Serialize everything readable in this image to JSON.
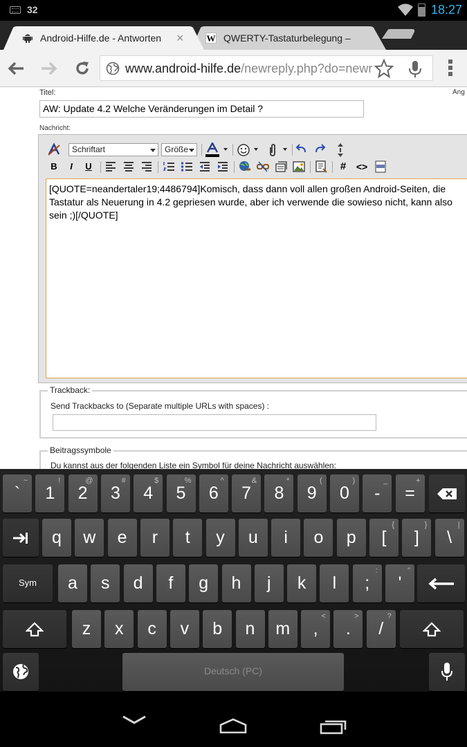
{
  "status_bar": {
    "notification_count": "32",
    "time": "18:27"
  },
  "tabs": [
    {
      "title": "Android-Hilfe.de - Antworten",
      "close": "×"
    },
    {
      "title": "QWERTY-Tastaturbelegung –",
      "favicon": "W"
    }
  ],
  "omnibox": {
    "url_host": "www.android-hilfe.de",
    "url_path": "/newreply.php?do=newrep"
  },
  "form": {
    "title_label": "Titel:",
    "right_edge_text": "Ang",
    "title_value": "AW: Update 4.2 Welche Veränderungen im Detail ?",
    "message_label": "Nachricht:",
    "font_select": "Schriftart",
    "size_select": "Größe",
    "bold": "B",
    "italic": "I",
    "underline": "U",
    "hash": "#",
    "code": "<>",
    "message_text": "[QUOTE=neandertaler19;4486794]Komisch, dass dann voll allen großen Android-Seiten, die Tastatur als Neuerung in 4.2 gepriesen wurde, aber ich verwende die sowieso nicht, kann also sein ;)[/QUOTE]",
    "trackback_legend": "Trackback:",
    "trackback_hint": "Send Trackbacks to (Separate multiple URLs with spaces) :",
    "symbols_legend": "Beitragssymbole",
    "symbols_text": "Du kannst aus der folgenden Liste ein Symbol für deine Nachricht auswählen:"
  },
  "keyboard": {
    "row1": [
      {
        "main": "`",
        "alt": "~"
      },
      {
        "main": "1",
        "alt": "!"
      },
      {
        "main": "2",
        "alt": "@"
      },
      {
        "main": "3",
        "alt": "#"
      },
      {
        "main": "4",
        "alt": "$"
      },
      {
        "main": "5",
        "alt": "%"
      },
      {
        "main": "6",
        "alt": "^"
      },
      {
        "main": "7",
        "alt": "&"
      },
      {
        "main": "8",
        "alt": "*"
      },
      {
        "main": "9",
        "alt": "("
      },
      {
        "main": "0",
        "alt": ")"
      },
      {
        "main": "-",
        "alt": "_"
      },
      {
        "main": "=",
        "alt": "+"
      }
    ],
    "row2": [
      {
        "main": "q",
        "alt": ""
      },
      {
        "main": "w",
        "alt": ""
      },
      {
        "main": "e",
        "alt": ""
      },
      {
        "main": "r",
        "alt": ""
      },
      {
        "main": "t",
        "alt": ""
      },
      {
        "main": "y",
        "alt": ""
      },
      {
        "main": "u",
        "alt": ""
      },
      {
        "main": "i",
        "alt": ""
      },
      {
        "main": "o",
        "alt": ""
      },
      {
        "main": "p",
        "alt": ""
      },
      {
        "main": "[",
        "alt": "{"
      },
      {
        "main": "]",
        "alt": "}"
      },
      {
        "main": "\\",
        "alt": "|"
      }
    ],
    "row3": [
      {
        "main": "a",
        "alt": ""
      },
      {
        "main": "s",
        "alt": ""
      },
      {
        "main": "d",
        "alt": ""
      },
      {
        "main": "f",
        "alt": ""
      },
      {
        "main": "g",
        "alt": ""
      },
      {
        "main": "h",
        "alt": ""
      },
      {
        "main": "j",
        "alt": ""
      },
      {
        "main": "k",
        "alt": ""
      },
      {
        "main": "l",
        "alt": ""
      },
      {
        "main": ";",
        "alt": ":"
      },
      {
        "main": "'",
        "alt": "\""
      }
    ],
    "row4": [
      {
        "main": "z",
        "alt": ""
      },
      {
        "main": "x",
        "alt": ""
      },
      {
        "main": "c",
        "alt": ""
      },
      {
        "main": "v",
        "alt": ""
      },
      {
        "main": "b",
        "alt": ""
      },
      {
        "main": "n",
        "alt": ""
      },
      {
        "main": "m",
        "alt": ""
      },
      {
        "main": ",",
        "alt": "<"
      },
      {
        "main": ".",
        "alt": ">"
      },
      {
        "main": "/",
        "alt": "?"
      }
    ],
    "sym_label": "Sym",
    "space_label": "Deutsch (PC)"
  },
  "colors": {
    "accent": "#33b5e5",
    "editor_border": "#e3a447",
    "key": "#525252"
  }
}
